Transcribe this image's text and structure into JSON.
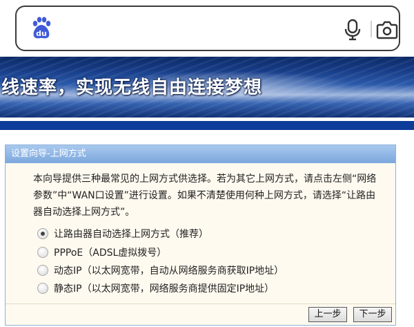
{
  "search": {
    "logo_icon": "baidu-paw-icon",
    "logo_text": "du",
    "mic_icon": "microphone-icon",
    "camera_icon": "camera-icon",
    "brand_color": "#3f5bd8"
  },
  "banner": {
    "text": "线速率，实现无线自由连接梦想"
  },
  "dialog": {
    "title": "设置向导-上网方式",
    "description": "本向导提供三种最常见的上网方式供选择。若为其它上网方式，请点击左侧“网络参数”中“WAN口设置”进行设置。如果不清楚使用何种上网方式，请选择“让路由器自动选择上网方式”。",
    "options": [
      {
        "label": "让路由器自动选择上网方式（推荐）",
        "checked": true
      },
      {
        "label": "PPPoE（ADSL虚拟拨号）",
        "checked": false
      },
      {
        "label": "动态IP（以太网宽带，自动从网络服务商获取IP地址）",
        "checked": false
      },
      {
        "label": "静态IP（以太网宽带，网络服务商提供固定IP地址）",
        "checked": false
      }
    ],
    "prev_label": "上一步",
    "next_label": "下一步"
  }
}
